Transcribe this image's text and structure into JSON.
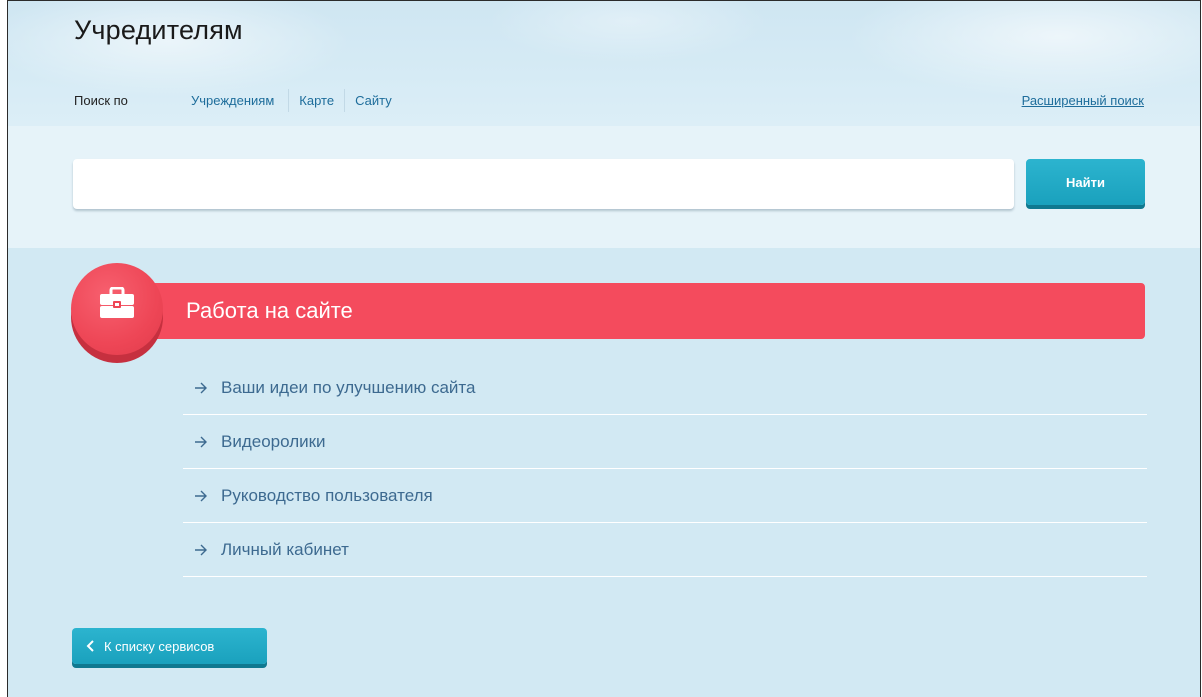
{
  "header": {
    "title": "Учредителям",
    "search_by_label": "Поиск по",
    "scope_tabs": [
      {
        "label": "Учреждениям"
      },
      {
        "label": "Карте"
      },
      {
        "label": "Сайту"
      }
    ],
    "advanced_search_link": "Расширенный поиск"
  },
  "search": {
    "input_value": "",
    "button_label": "Найти"
  },
  "section": {
    "title": "Работа на сайте",
    "icon": "briefcase-icon",
    "accent_color": "#f44b5d",
    "links": [
      {
        "label": "Ваши идеи по улучшению сайта",
        "icon": "arrow-right-icon"
      },
      {
        "label": "Видеоролики",
        "icon": "arrow-right-icon"
      },
      {
        "label": "Руководство пользователя",
        "icon": "arrow-right-icon"
      },
      {
        "label": "Личный кабинет",
        "icon": "arrow-right-icon"
      }
    ]
  },
  "back_button": {
    "label": "К списку сервисов",
    "icon": "chevron-left-icon"
  },
  "colors": {
    "button": "#1aa1bd",
    "link": "#3d6a90",
    "background": "#d2e9f3"
  }
}
